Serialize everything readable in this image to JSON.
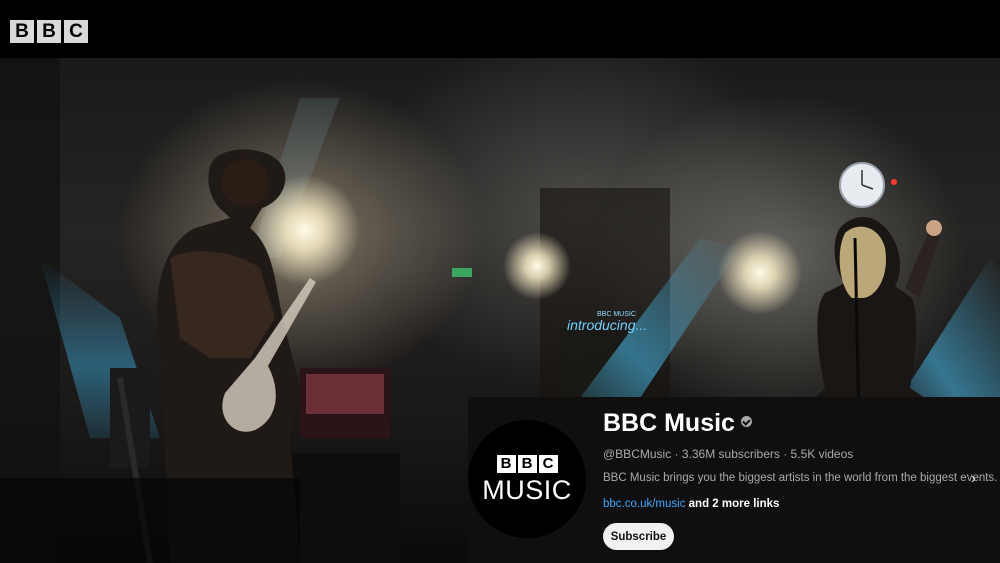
{
  "header": {
    "logo": [
      "B",
      "B",
      "C"
    ]
  },
  "video": {
    "stage_sign": "introducing...",
    "stage_sign_small": "BBC MUSIC"
  },
  "channel": {
    "avatar_bbc": [
      "B",
      "B",
      "C"
    ],
    "avatar_music": "MUSIC",
    "name": "BBC Music",
    "handle_stats": "@BBCMusic · 3.36M subscribers · 5.5K videos",
    "description": "BBC Music brings you the biggest artists in the world from the biggest events.",
    "link": "bbc.co.uk/music",
    "more_links": "and 2 more links",
    "subscribe_label": "Subscribe"
  },
  "colors": {
    "link": "#3ea6ff",
    "card_bg": "#0f0f0f",
    "stage_light_blue": "#3fb4e8"
  },
  "icons": [
    "verified-badge-icon",
    "chevron-right-icon"
  ]
}
